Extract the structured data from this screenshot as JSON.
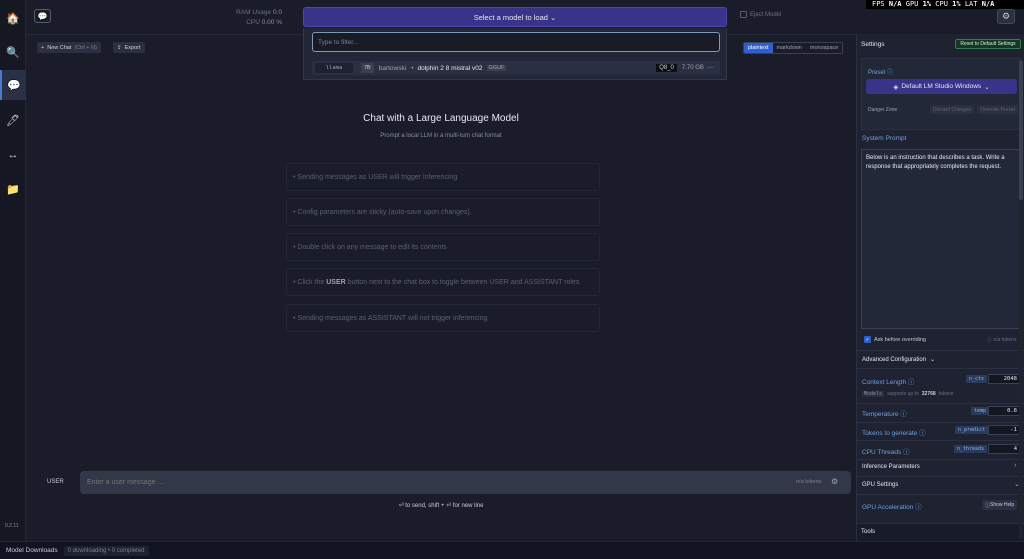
{
  "rail": {
    "items": [
      {
        "icon": "home-icon",
        "glyph": "🏠"
      },
      {
        "icon": "search-icon",
        "glyph": "🔍"
      },
      {
        "icon": "chat-icon",
        "glyph": "💬"
      },
      {
        "icon": "pencil-icon",
        "glyph": "🖊"
      },
      {
        "icon": "arrows-icon",
        "glyph": "↔"
      },
      {
        "icon": "folder-icon",
        "glyph": "📁"
      }
    ],
    "version": "0.2.11"
  },
  "top": {
    "ram_label": "RAM Usage",
    "ram_value": "0.0",
    "cpu_label": "CPU",
    "cpu_value": "0.00 %",
    "model_button_label": "Select a model to load ⌄",
    "eject_label": "Eject Model",
    "stats": {
      "fps": "FPS",
      "fps_val": "N/A",
      "gpu": "GPU",
      "gpu_val": "1%",
      "cpu": "CPU",
      "cpu_val": "1%",
      "lat": "LAT",
      "lat_val": "N/A"
    }
  },
  "header": {
    "new_chat": "New Chat",
    "new_chat_shortcut": "(Ctrl + N)",
    "export": "Export",
    "formats": [
      "plaintext",
      "markdown",
      "monospace"
    ],
    "active_format": "plaintext"
  },
  "dropdown": {
    "filter_placeholder": "Type to filter...",
    "model": {
      "arch": "llama",
      "params": "7B",
      "author": "bartowski",
      "separator": "•",
      "name": "dolphin 2 8 mistral v02",
      "format": "GGUF",
      "quant": "Q8_0",
      "size": "7.70 GB"
    }
  },
  "main": {
    "title": "Chat with a Large Language Model",
    "subtitle": "Prompt a local LLM in a multi-turn chat format",
    "tips": [
      {
        "pre": "• Sending messages as USER will trigger inferencing",
        "bold": "",
        "post": ""
      },
      {
        "pre": "• Config parameters are sticky (auto-save upon changes).",
        "bold": "",
        "post": ""
      },
      {
        "pre": "• Double click on any message to edit its contents",
        "bold": "",
        "post": ""
      },
      {
        "pre": "• Click the ",
        "bold": "USER",
        "post": " button next to the chat box to toggle between USER and ASSISTANT roles"
      },
      {
        "pre": "• Sending messages as ASSISTANT will not trigger inferencing",
        "bold": "",
        "post": ""
      }
    ],
    "role": "USER",
    "input_placeholder": "Enter a user message ...",
    "tokens": "n/a tokens",
    "send_hint": "⏎ to send, shift + ⏎ for new line"
  },
  "bottom": {
    "label": "Model Downloads",
    "status": "0 downloading • 0 completed"
  },
  "panel": {
    "title": "Settings",
    "reset": "Reset to Default Settings",
    "preset_label": "Preset",
    "preset_value": "Default LM Studio Windows",
    "danger_zone": "Danger Zone",
    "discard": "Discard Changes",
    "override": "Override Preset",
    "system_prompt_label": "System Prompt",
    "system_prompt": "Below is an instruction that describes a task. Write a response that appropriately completes the request.",
    "ask_label": "Ask before overriding",
    "n_tokens": "n/a tokens",
    "advanced": "Advanced Configuration",
    "context_length_label": "Context Length",
    "context_key": "n_ctx",
    "context_value": "2048",
    "ctx_note_key": "Models",
    "ctx_note_text": "supports up to",
    "ctx_note_value": "32768",
    "ctx_note_suffix": "tokens",
    "temperature_label": "Temperature",
    "temperature_key": "temp",
    "temperature_value": "0.8",
    "tokens_label": "Tokens to generate",
    "tokens_key": "n_predict",
    "tokens_value": "-1",
    "threads_label": "CPU Threads",
    "threads_key": "n_threads",
    "threads_value": "4",
    "inference_params": "Inference Parameters",
    "gpu_settings": "GPU Settings",
    "gpu_accel": "GPU Acceleration",
    "show_help": "Show Help",
    "tools": "Tools"
  }
}
